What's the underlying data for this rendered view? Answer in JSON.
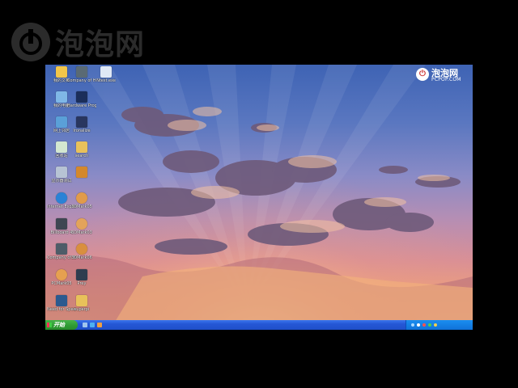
{
  "watermark": {
    "text": "泡泡网"
  },
  "corner_logo": {
    "name": "泡泡网",
    "domain": "PCPOP.COM"
  },
  "desktop": {
    "icons": [
      {
        "label": "我的文档",
        "icon": "my-documents-icon",
        "color": "#f2c64a"
      },
      {
        "label": "Company of Heroes",
        "icon": "company-of-heroes-icon",
        "color": "#5a6a74"
      },
      {
        "label": "Ntest.exe",
        "icon": "monitor-app-icon",
        "color": "#dfe8f5"
      },
      {
        "label": "我的电脑",
        "icon": "my-computer-icon",
        "color": "#7fb7e6"
      },
      {
        "label": "Hardware Prog Da",
        "icon": "hardware-tool-icon",
        "color": "#1b2e5a"
      },
      {
        "label": "网上邻居",
        "icon": "network-places-icon",
        "color": "#5aa0d8"
      },
      {
        "label": "Ironalize",
        "icon": "game-icon",
        "color": "#29365f"
      },
      {
        "label": "回收站",
        "icon": "recycle-bin-icon",
        "color": "#d3e7d0"
      },
      {
        "label": "search",
        "icon": "folder-icon",
        "color": "#e8c15a"
      },
      {
        "label": "显示器测试",
        "icon": "display-test-icon",
        "color": "#b7c3d4"
      },
      {
        "label": "",
        "icon": "image-app-icon",
        "color": "#d4882c"
      },
      {
        "label": "Internet Explorer",
        "icon": "internet-explorer-icon",
        "color": "#2a82d6"
      },
      {
        "label": "3DMark05",
        "icon": "3dmark-icon",
        "color": "#e19b4a"
      },
      {
        "label": "Billboard 4",
        "icon": "billboard-icon",
        "color": "#3e4652"
      },
      {
        "label": "3DMark03",
        "icon": "3dmark03-icon",
        "color": "#e3a35a"
      },
      {
        "label": "Company of Heroes",
        "icon": "company-of-heroes-2-icon",
        "color": "#4e5c68"
      },
      {
        "label": "3DMark06",
        "icon": "3dmark06-icon",
        "color": "#d98f3e"
      },
      {
        "label": "PCMark05",
        "icon": "pcmark-icon",
        "color": "#e6a050"
      },
      {
        "label": "Prey",
        "icon": "prey-icon",
        "color": "#2f3d4f"
      },
      {
        "label": "Need for Speed",
        "icon": "need-for-speed-icon",
        "color": "#2c5a8f"
      },
      {
        "label": "superpi",
        "icon": "superpi-folder-icon",
        "color": "#e8c15a"
      }
    ]
  },
  "taskbar": {
    "start_label": "开始",
    "quick_launch": [
      {
        "icon": "show-desktop-icon",
        "color": "#9fc4ee"
      },
      {
        "icon": "ie-quicklaunch-icon",
        "color": "#4db0f0"
      },
      {
        "icon": "media-player-icon",
        "color": "#f0a040"
      }
    ],
    "tray_icons": [
      {
        "icon": "network-tray-icon",
        "color": "#a8d8ff"
      },
      {
        "icon": "volume-tray-icon",
        "color": "#ffffff"
      },
      {
        "icon": "security-tray-icon",
        "color": "#ff5050"
      },
      {
        "icon": "antivirus-tray-icon",
        "color": "#50d050"
      },
      {
        "icon": "update-tray-icon",
        "color": "#f0d050"
      }
    ]
  }
}
